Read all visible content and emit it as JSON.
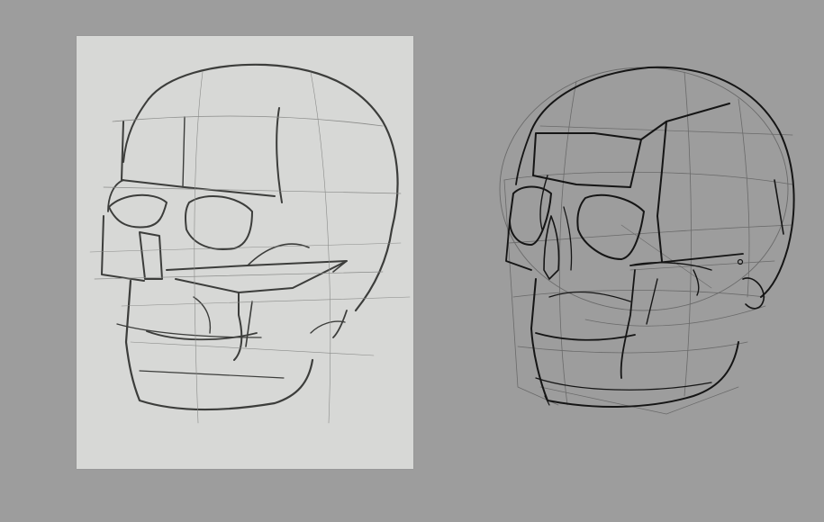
{
  "colors": {
    "background": "#9d9d9d",
    "paper": "#d7d8d6",
    "pencil_dark": "#3c3d3b",
    "pencil_light": "#8a8b89",
    "shading": "#6f706e",
    "ink_dark": "#151515",
    "ink_light": "#6a6a6a"
  },
  "artworks": [
    {
      "subject": "skull",
      "medium": "pencil-sketch-on-paper",
      "view": "three-quarter"
    },
    {
      "subject": "skull",
      "medium": "digital-line-construction",
      "view": "three-quarter"
    }
  ]
}
